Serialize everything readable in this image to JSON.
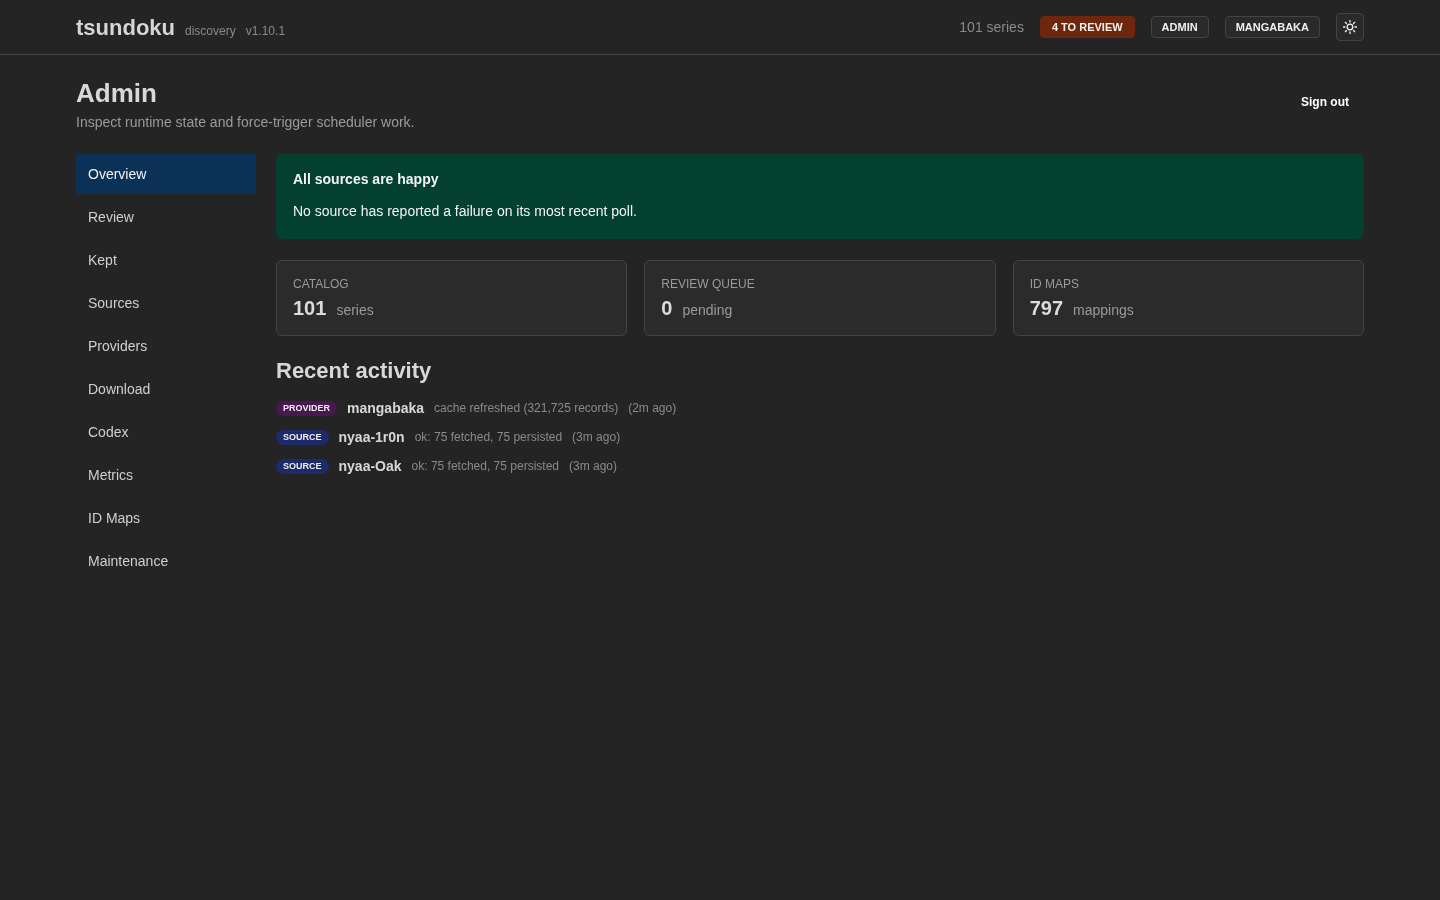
{
  "header": {
    "brand": "tsundoku",
    "app_name": "discovery",
    "version": "v1.10.1",
    "series_count": "101 series",
    "review_badge": "4 TO REVIEW",
    "account_buttons": [
      "ADMIN",
      "MANGABAKA"
    ]
  },
  "page": {
    "title": "Admin",
    "subtitle": "Inspect runtime state and force-trigger scheduler work.",
    "sign_out": "Sign out"
  },
  "sidebar": {
    "items": [
      {
        "label": "Overview",
        "selected": true
      },
      {
        "label": "Review",
        "selected": false
      },
      {
        "label": "Kept",
        "selected": false
      },
      {
        "label": "Sources",
        "selected": false
      },
      {
        "label": "Providers",
        "selected": false
      },
      {
        "label": "Download",
        "selected": false
      },
      {
        "label": "Codex",
        "selected": false
      },
      {
        "label": "Metrics",
        "selected": false
      },
      {
        "label": "ID Maps",
        "selected": false
      },
      {
        "label": "Maintenance",
        "selected": false
      }
    ]
  },
  "status_banner": {
    "title": "All sources are happy",
    "message": "No source has reported a failure on its most recent poll."
  },
  "stats": [
    {
      "label": "CATALOG",
      "value": "101",
      "unit": "series"
    },
    {
      "label": "REVIEW QUEUE",
      "value": "0",
      "unit": "pending"
    },
    {
      "label": "ID MAPS",
      "value": "797",
      "unit": "mappings"
    }
  ],
  "recent_activity": {
    "title": "Recent activity",
    "items": [
      {
        "tag": "PROVIDER",
        "color": "#4a1850",
        "name": "mangabaka",
        "detail": "cache refreshed (321,725 records)",
        "time": "(2m ago)"
      },
      {
        "tag": "SOURCE",
        "color": "#1d2b6b",
        "name": "nyaa-1r0n",
        "detail": "ok: 75 fetched, 75 persisted",
        "time": "(3m ago)"
      },
      {
        "tag": "SOURCE",
        "color": "#1d2b6b",
        "name": "nyaa-Oak",
        "detail": "ok: 75 fetched, 75 persisted",
        "time": "(3m ago)"
      }
    ]
  }
}
